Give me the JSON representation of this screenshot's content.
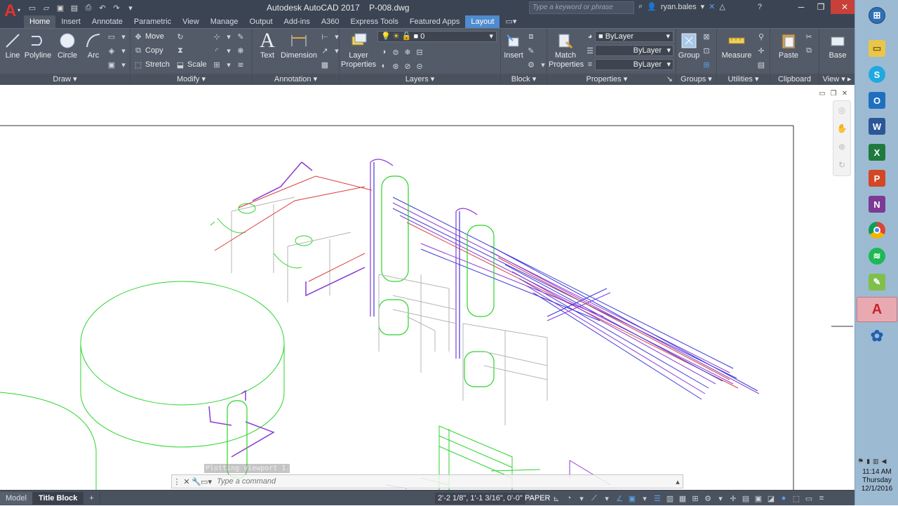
{
  "titlebar": {
    "app_name": "Autodesk AutoCAD 2017",
    "file_name": "P-008.dwg",
    "search_placeholder": "Type a keyword or phrase",
    "user": "ryan.bales",
    "qat_icons": [
      "new-icon",
      "open-icon",
      "save-icon",
      "save-as-icon",
      "print-icon",
      "undo-icon",
      "redo-icon"
    ]
  },
  "tabs": [
    "Home",
    "Insert",
    "Annotate",
    "Parametric",
    "View",
    "Manage",
    "Output",
    "Add-ins",
    "A360",
    "Express Tools",
    "Featured Apps",
    "Layout"
  ],
  "ribbon": {
    "draw": {
      "label": "Draw",
      "line": "Line",
      "polyline": "Polyline",
      "circle": "Circle",
      "arc": "Arc"
    },
    "modify": {
      "label": "Modify",
      "move": "Move",
      "copy": "Copy",
      "stretch": "Stretch",
      "scale": "Scale"
    },
    "annotation": {
      "label": "Annotation",
      "text": "Text",
      "dimension": "Dimension"
    },
    "layers": {
      "label": "Layers",
      "layer_properties_1": "Layer",
      "layer_properties_2": "Properties",
      "current_layer": "0"
    },
    "block": {
      "label": "Block",
      "insert": "Insert"
    },
    "properties": {
      "label": "Properties",
      "match_1": "Match",
      "match_2": "Properties",
      "color": "ByLayer",
      "linetype": "ByLayer",
      "lineweight": "ByLayer"
    },
    "groups": {
      "label": "Groups",
      "group": "Group"
    },
    "utilities": {
      "label": "Utilities",
      "measure": "Measure"
    },
    "clipboard": {
      "label": "Clipboard",
      "paste": "Paste"
    },
    "view": {
      "label": "View",
      "base": "Base"
    }
  },
  "command": {
    "history": "Plotting viewport 1.",
    "placeholder": "Type a command"
  },
  "statusbar": {
    "layout_tabs": [
      "Model",
      "Title Block"
    ],
    "active_layout": "Title Block",
    "coordinates": "2'-2 1/8\", 1'-1 3/16\", 0'-0\"",
    "space": "PAPER"
  },
  "taskbar": {
    "apps": [
      "windows-start",
      "file-explorer",
      "skype",
      "outlook",
      "word",
      "excel",
      "powerpoint",
      "onenote",
      "chrome",
      "spotify",
      "notepad",
      "autocad",
      "network-app"
    ],
    "active_app": "autocad",
    "time": "11:14 AM",
    "day": "Thursday",
    "date": "12/1/2016"
  },
  "colors": {
    "title_bg": "#3b4453",
    "ribbon_bg": "#535b68",
    "layout_tab": "#4f8bcf",
    "pipe_blue": "#3b3bd9",
    "pipe_purple": "#8a3ad6",
    "pipe_red": "#d93b3b",
    "equipment_green": "#2bd42b",
    "structure_gray": "#b5b5b5"
  }
}
